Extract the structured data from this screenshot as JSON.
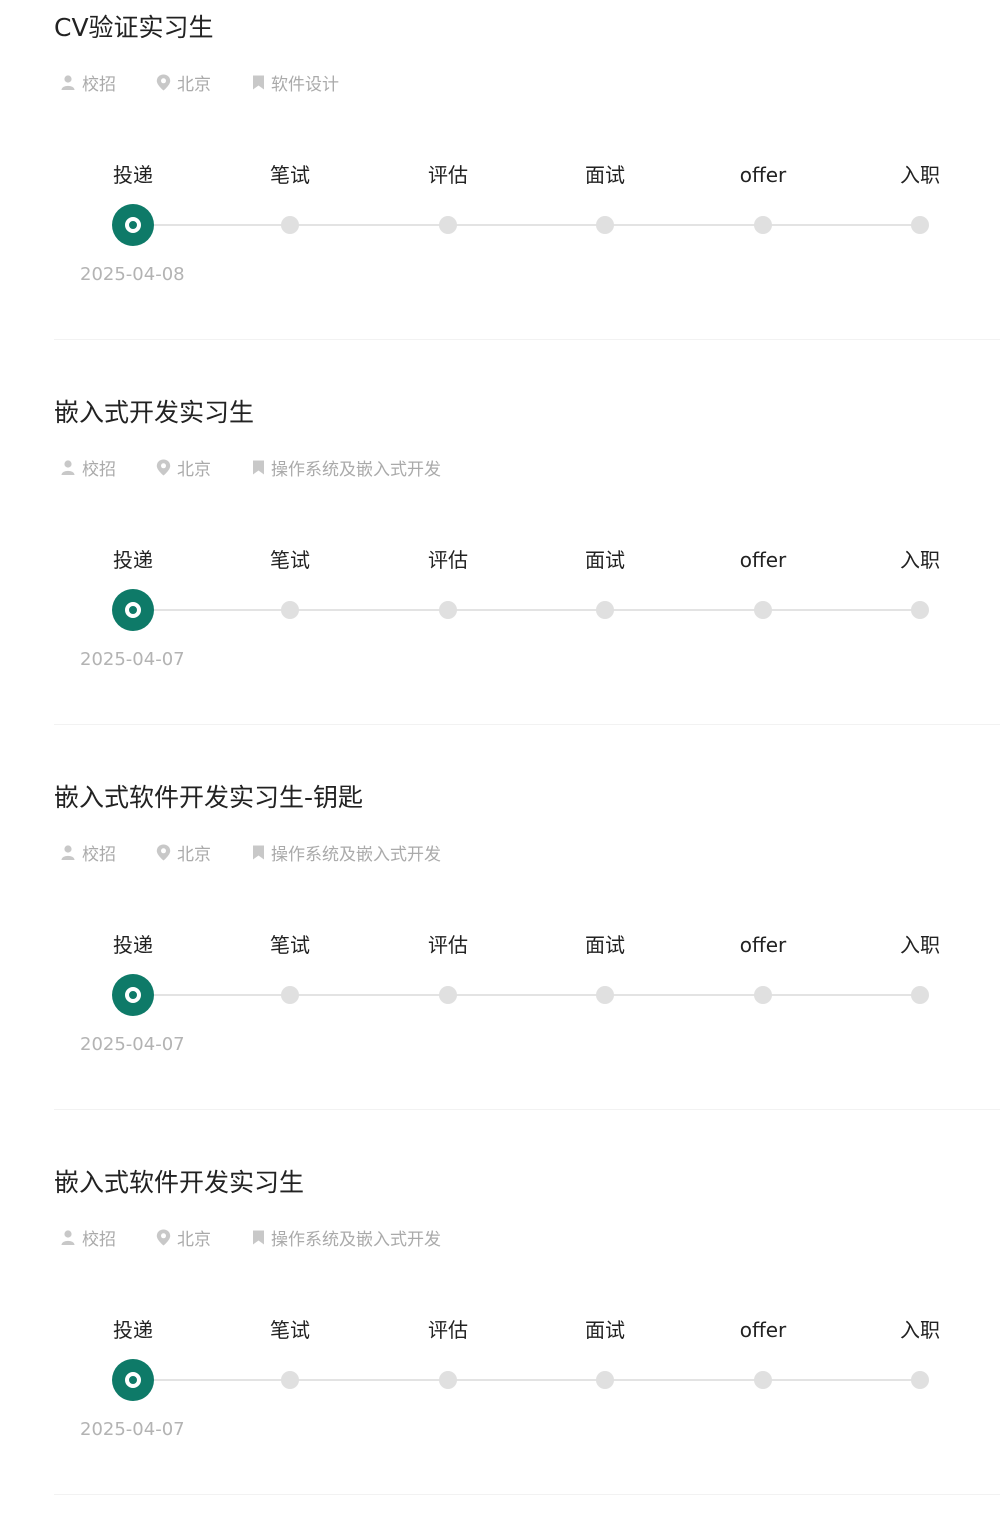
{
  "stages": [
    "投递",
    "笔试",
    "评估",
    "面试",
    "offer",
    "入职"
  ],
  "colors": {
    "active": "#0e7a68",
    "inactive": "#e0e0e0",
    "meta": "#aaaaaa"
  },
  "icons": {
    "type": "person-icon",
    "city": "location-pin-icon",
    "category": "bookmark-icon"
  },
  "applications": [
    {
      "title": "CV验证实习生",
      "type": "校招",
      "city": "北京",
      "category": "软件设计",
      "date": "2025-04-08",
      "current_stage": 0
    },
    {
      "title": "嵌入式开发实习生",
      "type": "校招",
      "city": "北京",
      "category": "操作系统及嵌入式开发",
      "date": "2025-04-07",
      "current_stage": 0
    },
    {
      "title": "嵌入式软件开发实习生-钥匙",
      "type": "校招",
      "city": "北京",
      "category": "操作系统及嵌入式开发",
      "date": "2025-04-07",
      "current_stage": 0
    },
    {
      "title": "嵌入式软件开发实习生",
      "type": "校招",
      "city": "北京",
      "category": "操作系统及嵌入式开发",
      "date": "2025-04-07",
      "current_stage": 0
    }
  ]
}
